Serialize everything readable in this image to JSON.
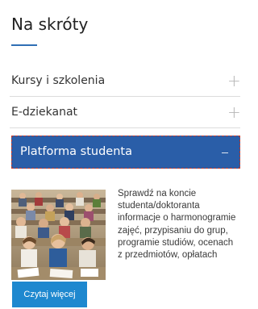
{
  "widget": {
    "title": "Na skróty",
    "accent_color": "#2f6fb5"
  },
  "accordion": {
    "items": [
      {
        "label": "Kursy i szkolenia",
        "toggle": "+",
        "expanded": false
      },
      {
        "label": "E-dziekanat",
        "toggle": "+",
        "expanded": false
      },
      {
        "label": "Platforma studenta",
        "toggle": "–",
        "expanded": true
      }
    ],
    "active_color": "#2a5ea8"
  },
  "panel": {
    "image_icon": "students-in-lecture-hall-photo",
    "description": "Sprawdź na koncie studenta/doktoranta informacje o harmonogramie zajęć, przypisaniu do grup, programie studiów, ocenach z przedmiotów, opłatach",
    "button_label": "Czytaj więcej",
    "button_color": "#1e88cf"
  }
}
